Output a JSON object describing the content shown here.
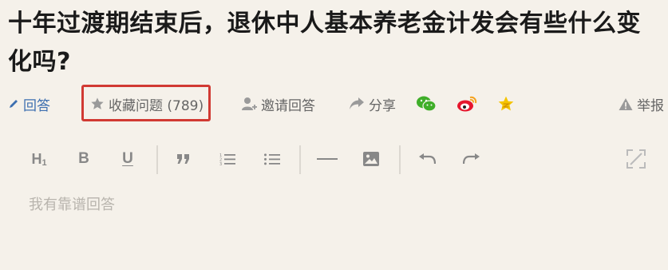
{
  "question": {
    "title": "十年过渡期结束后，退休中人基本养老金计发会有些什么变化吗?"
  },
  "actions": {
    "answer": "回答",
    "collect": "收藏问题 (789)",
    "invite": "邀请回答",
    "share": "分享",
    "report": "举报"
  },
  "toolbar": {
    "h1": "H",
    "h1_sub": "1",
    "bold": "B",
    "underline": "U"
  },
  "editor": {
    "placeholder": "我有靠谱回答"
  },
  "colors": {
    "background": "#f5f1ea",
    "highlight": "#d13a33",
    "link": "#3d6fb0",
    "wechat": "#3fae29",
    "weibo": "#e6162d",
    "qzone": "#f5c400"
  }
}
